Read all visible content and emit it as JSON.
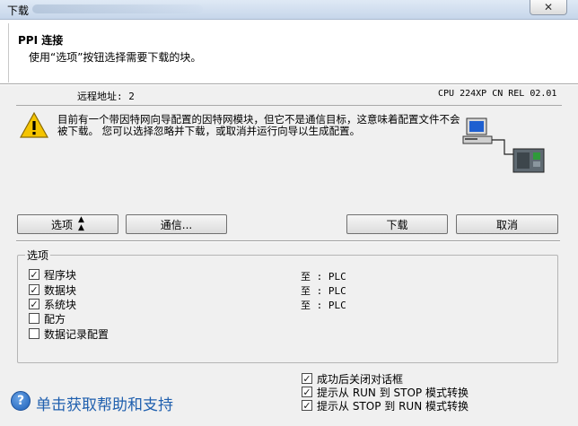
{
  "window": {
    "title": "下载",
    "close_label": "✕"
  },
  "header": {
    "title": "PPI 连接",
    "subtitle": "使用“选项”按钮选择需要下载的块。"
  },
  "info": {
    "remote_address": "远程地址:  2",
    "cpu": "CPU 224XP CN REL 02.01"
  },
  "warning": {
    "icon": "warning-icon",
    "text": "目前有一个带因特网向导配置的因特网模块，但它不是通信目标，这意味着配置文件不会被下载。 您可以选择忽略并下载，或取消并运行向导以生成配置。"
  },
  "buttons": {
    "options": "选项",
    "communication": "通信...",
    "download": "下载",
    "cancel": "取消"
  },
  "options_group": {
    "label": "选项",
    "items": [
      {
        "label": "程序块",
        "checked": true,
        "target": "至 : PLC"
      },
      {
        "label": "数据块",
        "checked": true,
        "target": "至 : PLC"
      },
      {
        "label": "系统块",
        "checked": true,
        "target": "至 : PLC"
      },
      {
        "label": "配方",
        "checked": false,
        "target": ""
      },
      {
        "label": "数据记录配置",
        "checked": false,
        "target": ""
      }
    ]
  },
  "post_options": [
    {
      "label": "成功后关闭对话框",
      "checked": true
    },
    {
      "label": "提示从 RUN 到 STOP 模式转换",
      "checked": true
    },
    {
      "label": "提示从 STOP 到 RUN 模式转换",
      "checked": true
    }
  ],
  "help": {
    "text": "单击获取帮助和支持",
    "icon": "help-icon"
  },
  "colors": {
    "help_link": "#1f5fae",
    "title_bar": "#c6d6ea"
  }
}
